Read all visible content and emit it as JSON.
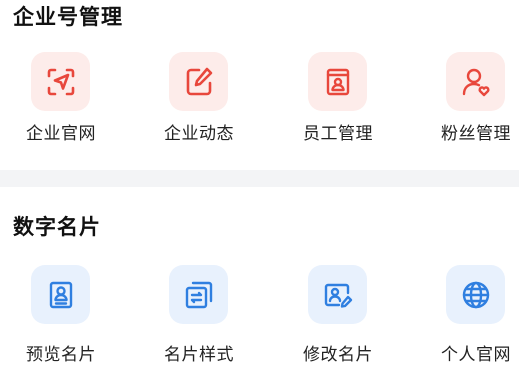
{
  "colors": {
    "accent_red": "#e8473c",
    "accent_blue": "#2f7fe0",
    "divider": "#f3f4f6"
  },
  "enterprise": {
    "title": "企业号管理",
    "items": [
      {
        "label": "企业官网",
        "icon": "send-icon"
      },
      {
        "label": "企业动态",
        "icon": "edit-icon"
      },
      {
        "label": "员工管理",
        "icon": "staff-card-icon"
      },
      {
        "label": "粉丝管理",
        "icon": "user-heart-icon"
      }
    ]
  },
  "card": {
    "title": "数字名片",
    "items": [
      {
        "label": "预览名片",
        "icon": "contact-card-icon"
      },
      {
        "label": "名片样式",
        "icon": "card-style-icon"
      },
      {
        "label": "修改名片",
        "icon": "edit-card-icon"
      },
      {
        "label": "个人官网",
        "icon": "globe-icon"
      }
    ]
  }
}
